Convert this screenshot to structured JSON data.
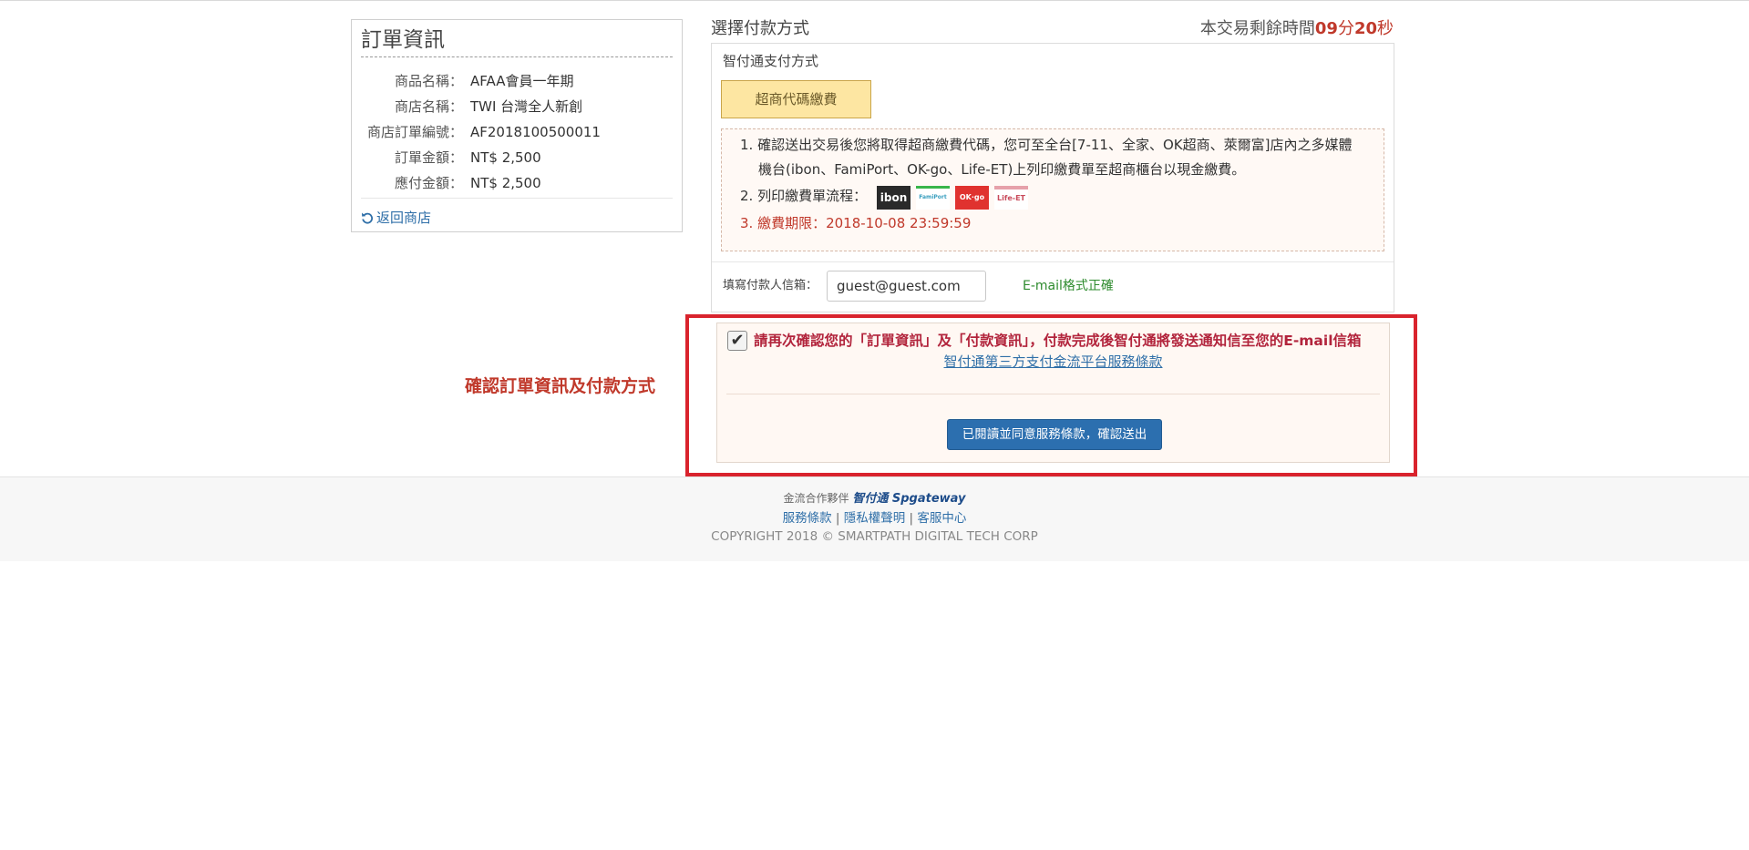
{
  "order": {
    "title": "訂單資訊",
    "rows": [
      {
        "label": "商品名稱：",
        "value": "AFAA會員一年期"
      },
      {
        "label": "商店名稱：",
        "value": "TWI 台灣全人新創"
      },
      {
        "label": "商店訂單編號：",
        "value": "AF2018100500011"
      },
      {
        "label": "訂單金額：",
        "value": "NT$ 2,500"
      },
      {
        "label": "應付金額：",
        "value": "NT$ 2,500"
      }
    ],
    "back_label": "返回商店"
  },
  "payment": {
    "heading": "選擇付款方式",
    "timer": {
      "prefix": "本交易剩餘時間",
      "minutes": "09",
      "minutes_unit": "分",
      "seconds": "20",
      "seconds_unit": "秒"
    },
    "subtitle": "智付通支付方式",
    "method_button": "超商代碼繳費",
    "info": {
      "line1": "1. 確認送出交易後您將取得超商繳費代碼，您可至全台[7-11、全家、OK超商、萊爾富]店內之多媒體",
      "line1b": "機台(ibon、FamiPort、OK-go、Life-ET)上列印繳費單至超商櫃台以現金繳費。",
      "line2": "2. 列印繳費單流程：",
      "line3": "3. 繳費期限：2018-10-08 23:59:59",
      "logos": [
        "ibon",
        "FamiPort",
        "OK·go",
        "Life-ET"
      ]
    },
    "email_label": "填寫付款人信箱：",
    "email_value": "guest@guest.com",
    "email_status": "E-mail格式正確"
  },
  "confirm": {
    "side_label": "確認訂單資訊及付款方式",
    "checkbox_mark": "✔",
    "text": "請再次確認您的「訂單資訊」及「付款資訊」，付款完成後智付通將發送通知信至您的E-mail信箱",
    "terms_link": "智付通第三方支付金流平台服務條款",
    "submit_label": "已閱讀並同意服務條款，確認送出"
  },
  "footer": {
    "partner_prefix": "金流合作夥伴",
    "partner_brand": "智付通 Spgateway",
    "links": [
      "服務條款",
      "隱私權聲明",
      "客服中心"
    ],
    "separator": "|",
    "copyright": "COPYRIGHT 2018 © SMARTPATH DIGITAL TECH CORP"
  }
}
